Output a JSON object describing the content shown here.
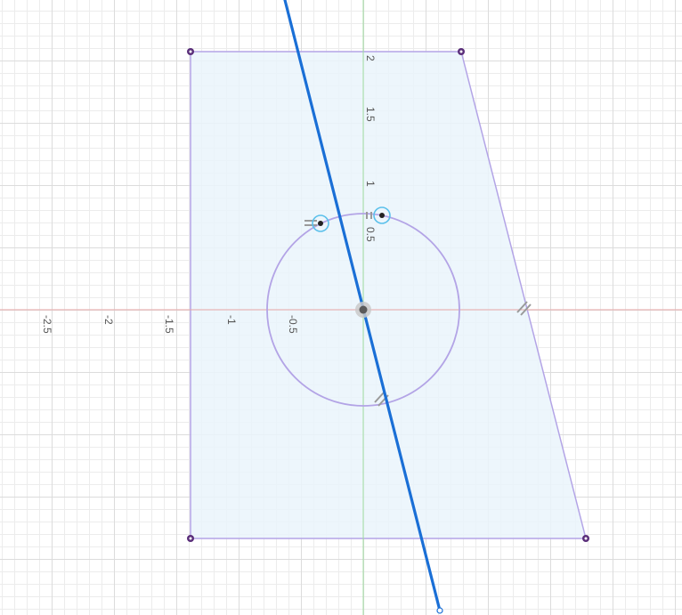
{
  "canvas": {
    "background": "#ffffff",
    "grid_minor_color": "#ececec",
    "grid_major_color": "#dcdcdc"
  },
  "axes": {
    "x_axis_color": "#e8a7a7",
    "y_axis_color": "#9fdc9f",
    "x_tick_labels": [
      "-2.5",
      "-2",
      "-1.5",
      "-1",
      "-0.5"
    ],
    "y_tick_labels": [
      "2",
      "1.5",
      "1",
      "0.5"
    ]
  },
  "sketch": {
    "profile_fill": "#eaf4fb",
    "profile_stroke": "#b3a4e6",
    "construction_line_color": "#1a6fd6",
    "point_color": "#5a2f7a",
    "constraint_circle_color": "#5bc0eb",
    "glyph_color": "#9a9a9a",
    "polygon": [
      [
        -1.5,
        2.25
      ],
      [
        0.84,
        2.25
      ],
      [
        1.93,
        -2.23
      ],
      [
        -1.5,
        -2.23
      ]
    ],
    "circle": {
      "center": [
        0,
        0
      ],
      "radius": 0.83
    },
    "line": {
      "start": [
        -0.68,
        2.7
      ],
      "end": [
        0.67,
        -2.6
      ]
    },
    "vertex_points": [
      [
        -1.5,
        2.25
      ],
      [
        0.84,
        2.25
      ],
      [
        1.93,
        -2.23
      ],
      [
        -1.5,
        -2.23
      ]
    ],
    "constrained_points": [
      [
        -0.37,
        0.74
      ],
      [
        0.17,
        0.81
      ]
    ],
    "origin": [
      0,
      0
    ]
  }
}
